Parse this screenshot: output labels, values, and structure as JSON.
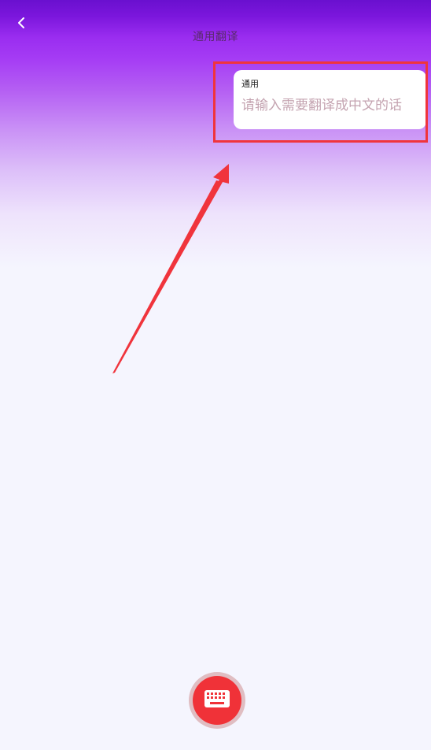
{
  "header": {
    "title": "通用翻译",
    "back_icon": "chevron-left-icon"
  },
  "card": {
    "label": "通用",
    "placeholder": "请输入需要翻译成中文的话"
  },
  "keyboard_button": {
    "icon": "keyboard-icon"
  },
  "colors": {
    "gradient_top": "#6a10cf",
    "gradient_mid": "#a53cf4",
    "background": "#f5f5fe",
    "highlight": "#f0343c",
    "arrow": "#f0343c",
    "keyboard_button": "#f03238",
    "keyboard_button_halo": "#e0bdc2",
    "placeholder_text": "#c4a3b0"
  }
}
